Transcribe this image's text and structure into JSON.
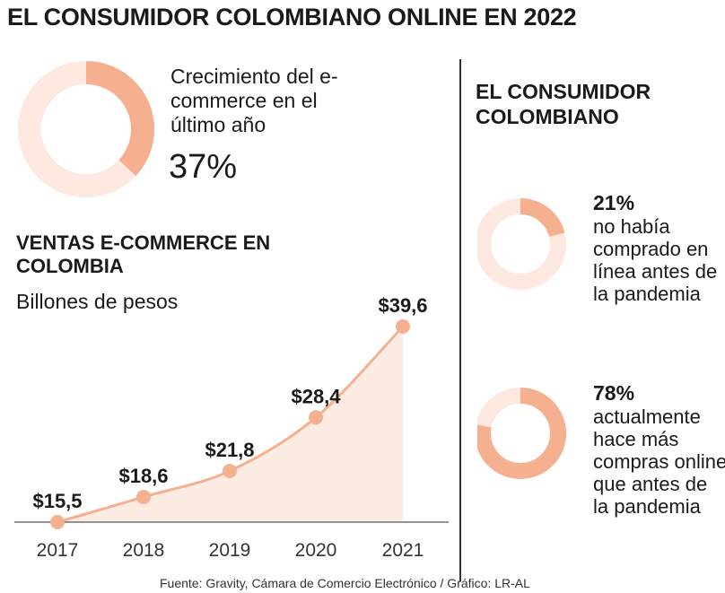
{
  "title": "EL CONSUMIDOR COLOMBIANO ONLINE EN 2022",
  "growth": {
    "text": "Crecimiento del e-commerce en el último año",
    "value": "37%",
    "percent": 37
  },
  "ventas": {
    "title": "VENTAS E-COMMERCE EN COLOMBIA",
    "subtitle": "Billones de pesos"
  },
  "side": {
    "title": "EL CONSUMIDOR COLOMBIANO",
    "stats": [
      {
        "pct_label": "21%",
        "percent": 21,
        "text": "no había comprado en línea antes de la pandemia"
      },
      {
        "pct_label": "78%",
        "percent": 78,
        "text": "actualmente hace más compras online que antes de la pandemia"
      }
    ]
  },
  "source": "Fuente: Gravity, Cámara de Comercio Electrónico / Gráfico: LR-AL",
  "colors": {
    "accent": "#f5b090",
    "light": "#fde9df",
    "area": "#fdece4"
  },
  "chart_data": {
    "type": "area",
    "categories": [
      "2017",
      "2018",
      "2019",
      "2020",
      "2021"
    ],
    "values": [
      15.5,
      18.6,
      21.8,
      28.4,
      39.6
    ],
    "labels": [
      "$15,5",
      "$18,6",
      "$21,8",
      "$28,4",
      "$39,6"
    ],
    "ylabel": "Billones de pesos",
    "ylim": [
      15.5,
      39.6
    ]
  }
}
